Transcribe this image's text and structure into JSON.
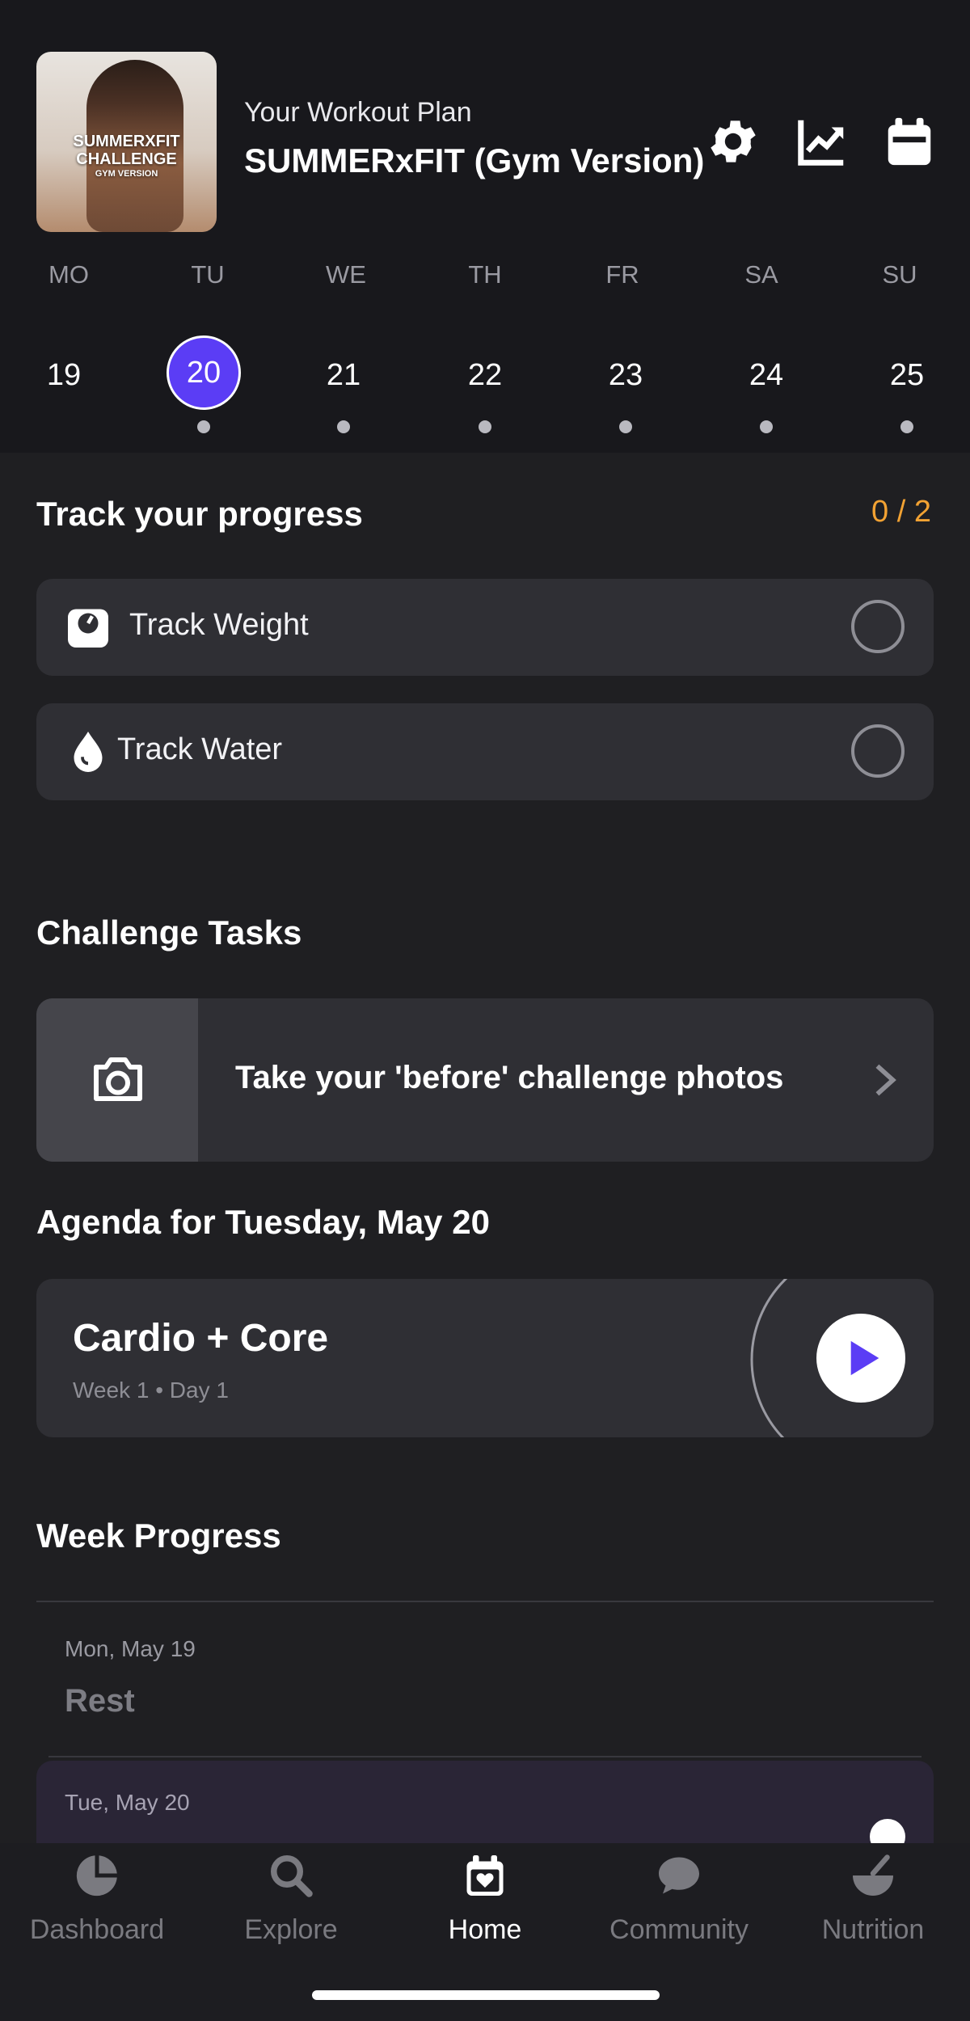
{
  "header": {
    "thumbnail": {
      "line1": "SUMMERXFIT",
      "line2": "CHALLENGE",
      "line3": "GYM VERSION"
    },
    "plan_label": "Your Workout Plan",
    "plan_name": "SUMMERxFIT (Gym Version)",
    "icons": [
      "gear-icon",
      "trend-chart-icon",
      "calendar-icon"
    ]
  },
  "week": {
    "days": [
      "MO",
      "TU",
      "WE",
      "TH",
      "FR",
      "SA",
      "SU"
    ],
    "dates": [
      "19",
      "20",
      "21",
      "22",
      "23",
      "24",
      "25"
    ],
    "selected_date": "20",
    "accent_color": "#5b3df5"
  },
  "progress": {
    "title": "Track your progress",
    "count": "0 / 2",
    "count_color": "#f2a233",
    "items": [
      {
        "label": "Track Weight",
        "icon": "scale-icon"
      },
      {
        "label": "Track Water",
        "icon": "water-drop-icon"
      }
    ]
  },
  "tasks": {
    "title": "Challenge Tasks",
    "items": [
      {
        "label": "Take your 'before' challenge photos",
        "icon": "camera-icon"
      }
    ]
  },
  "agenda": {
    "title": "Agenda for Tuesday, May 20",
    "workout": {
      "name": "Cardio + Core",
      "subtitle": "Week 1 • Day 1"
    }
  },
  "week_progress": {
    "title": "Week Progress",
    "entries": [
      {
        "day": "Mon, May 19",
        "status": "Rest"
      },
      {
        "day": "Tue, May 20"
      }
    ]
  },
  "tabbar": {
    "active": "Home",
    "tabs": [
      {
        "label": "Dashboard",
        "icon": "pie-chart-icon"
      },
      {
        "label": "Explore",
        "icon": "search-icon"
      },
      {
        "label": "Home",
        "icon": "calendar-heart-icon"
      },
      {
        "label": "Community",
        "icon": "chat-bubble-icon"
      },
      {
        "label": "Nutrition",
        "icon": "bowl-icon"
      }
    ]
  }
}
